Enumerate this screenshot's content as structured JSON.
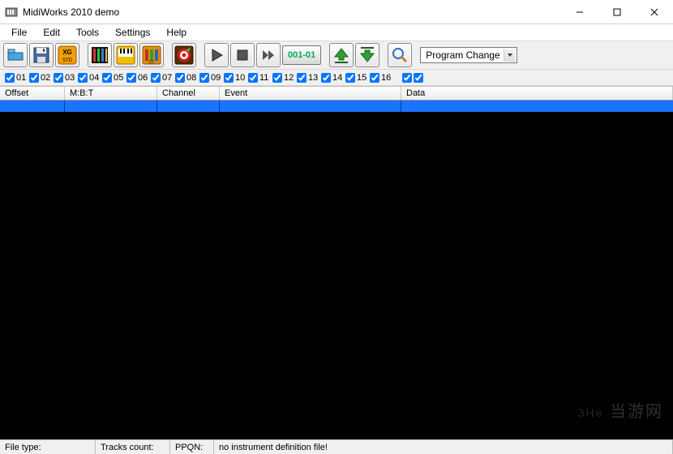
{
  "title": "MidiWorks 2010 demo",
  "menu": {
    "file": "File",
    "edit": "Edit",
    "tools": "Tools",
    "settings": "Settings",
    "help": "Help"
  },
  "toolbar": {
    "counter": "001-01",
    "filter_label": "Program Change"
  },
  "channels": [
    "01",
    "02",
    "03",
    "04",
    "05",
    "06",
    "07",
    "08",
    "09",
    "10",
    "11",
    "12",
    "13",
    "14",
    "15",
    "16"
  ],
  "columns": {
    "offset": "Offset",
    "mbt": "M:B:T",
    "channel": "Channel",
    "event": "Event",
    "data": "Data"
  },
  "status": {
    "filetype": "File type:",
    "tracks": "Tracks count:",
    "ppqn": "PPQN:",
    "message": "no instrument definition file!"
  },
  "watermark": "当游网"
}
